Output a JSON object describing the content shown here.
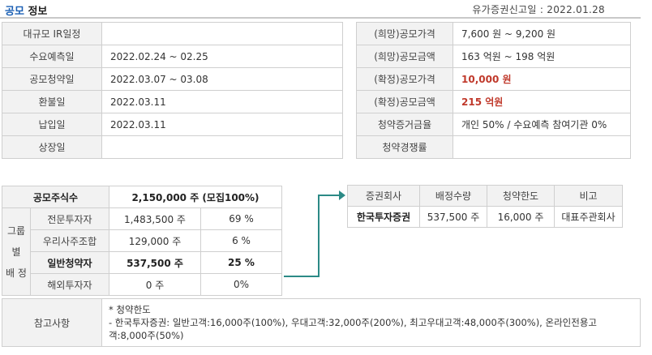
{
  "header": {
    "title_prefix": "공모",
    "title_suffix": "정보",
    "filing_date": "유가증권신고일 : 2022.01.28"
  },
  "schedule": [
    {
      "label": "대규모 IR일정",
      "value": ""
    },
    {
      "label": "수요예측일",
      "value": "2022.02.24 ~ 02.25"
    },
    {
      "label": "공모청약일",
      "value": "2022.03.07 ~ 03.08"
    },
    {
      "label": "환불일",
      "value": "2022.03.11"
    },
    {
      "label": "납입일",
      "value": "2022.03.11"
    },
    {
      "label": "상장일",
      "value": ""
    }
  ],
  "pricing": [
    {
      "label": "(희망)공모가격",
      "value": "7,600 원 ~ 9,200 원"
    },
    {
      "label": "(희망)공모금액",
      "value": "163 억원  ~ 198 억원"
    },
    {
      "label": "(확정)공모가격",
      "value": "10,000 원"
    },
    {
      "label": "(확정)공모금액",
      "value": "215 억원"
    },
    {
      "label": "청약증거금율",
      "value": "개인 50% / 수요예측 참여기관 0%"
    },
    {
      "label": "청약경쟁률",
      "value": ""
    }
  ],
  "allocation": {
    "total_label": "공모주식수",
    "total_value": "2,150,000 주 (모집100%)",
    "group_label_1": "그룹별",
    "group_label_2": "배  정",
    "rows": [
      {
        "name": "전문투자자",
        "shares": "1,483,500 주",
        "pct": "69 %"
      },
      {
        "name": "우리사주조합",
        "shares": "129,000 주",
        "pct": "6 %"
      },
      {
        "name": "일반청약자",
        "shares": "537,500 주",
        "pct": "25 %"
      },
      {
        "name": "해외투자자",
        "shares": "0 주",
        "pct": "0%"
      }
    ]
  },
  "underwriters": {
    "headers": [
      "증권회사",
      "배정수량",
      "청약한도",
      "비고"
    ],
    "rows": [
      {
        "company": "한국투자증권",
        "qty": "537,500 주",
        "limit": "16,000 주",
        "note": "대표주관회사"
      }
    ]
  },
  "notes": {
    "label": "참고사항",
    "line1": "* 청약한도",
    "line2": "- 한국투자증권: 일반고객:16,000주(100%), 우대고객:32,000주(200%), 최고우대고객:48,000주(300%), 온라인전용고객:8,000주(50%)"
  }
}
